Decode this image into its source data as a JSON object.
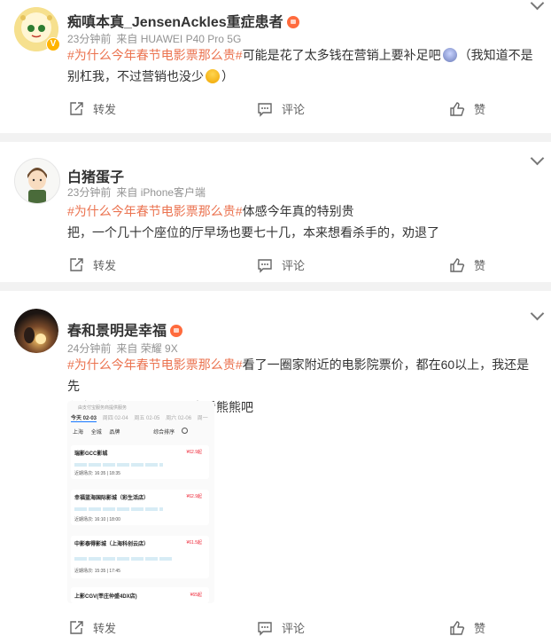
{
  "posts": [
    {
      "username": "痴嗔本真_JensenAckles重症患者",
      "time": "23分钟前",
      "source": "来自 HUAWEI P40 Pro 5G",
      "topic": "#为什么今年春节电影票那么贵#",
      "text_line1": "可能是花了太多钱在营销上要补足吧",
      "text_line1b": "（我知道不是",
      "text_line2": "别杠我，不过营销也没少",
      "text_line2b": "）",
      "repost_label": "转发",
      "comment_label": "评论",
      "like_label": "赞"
    },
    {
      "username": "白猪蛋子",
      "time": "23分钟前",
      "source": "来自 iPhone客户端",
      "topic": "#为什么今年春节电影票那么贵#",
      "text_line1": "体感今年真的特别贵",
      "text_line2": "把，一个几十个座位的厅早场也要七十几，本来想看杀手的，劝退了",
      "repost_label": "转发",
      "comment_label": "评论",
      "like_label": "赞"
    },
    {
      "username": "春和景明是幸福",
      "time": "24分钟前",
      "source": "来自 荣耀 9X",
      "topic": "#为什么今年春节电影票那么贵#",
      "text_line1": "看了一圈家附近的电影院票价，都在60以上，我还是先",
      "text_line2": "在家待着舒服，后面再去看熊熊吧",
      "repost_label": "转发",
      "comment_label": "评论",
      "like_label": "赞",
      "screenshot": {
        "header": "由支付宝服务商提供服务",
        "dates": [
          "今天 02-03",
          "周四 02-04",
          "周五 02-05",
          "周六 02-06",
          "周一"
        ],
        "filters": [
          "上海",
          "全城",
          "品牌",
          "综合排序"
        ],
        "cinemas": [
          {
            "name": "瑞影GCC影城",
            "price": "¥62.9起",
            "time": "近期场次: 16:35 | 18:35"
          },
          {
            "name": "幸福蓝海国际影城（彩生活店）",
            "price": "¥62.9起",
            "time": "近期场次: 16:10 | 18:00"
          },
          {
            "name": "中影泰得影城（上海科创云店）",
            "price": "¥61.5起",
            "time": "近期场次: 15:35 | 17:45"
          },
          {
            "name": "上影CGV(莘庄仲盛4DX店)",
            "price": "¥65起",
            "time": ""
          }
        ]
      }
    }
  ],
  "colors": {
    "topic": "#eb7350",
    "meta": "#939393",
    "separator": "#f2f2f2"
  }
}
